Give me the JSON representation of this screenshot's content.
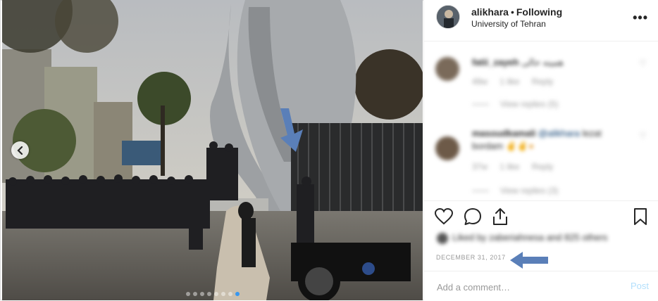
{
  "post": {
    "username": "alikhara",
    "separator": "•",
    "follow_state": "Following",
    "location": "University of Tehran",
    "more_icon": "more-options-icon",
    "date": "DECEMBER 31, 2017"
  },
  "comments": [
    {
      "username": "fatii_zayeh",
      "text": "همینه حالی",
      "meta": [
        "49w",
        "1 like",
        "Reply"
      ],
      "replies": "View replies (5)"
    },
    {
      "username": "masoudkamali",
      "mention": "@alikhara",
      "text": "lezat",
      "text2": "bordam",
      "emoji": "✌✌●",
      "meta": [
        "37w",
        "1 like",
        "Reply"
      ],
      "replies": "View replies (3)"
    }
  ],
  "likes_text": "Liked by zaberiahnesa and 825 others",
  "add_comment": {
    "placeholder": "Add a comment…",
    "post_label": "Post"
  },
  "carousel": {
    "dot_count": 8,
    "active_index": 7
  },
  "colors": {
    "accent_blue": "#3897f0",
    "post_disabled": "#b2dffc",
    "annotation_arrow": "#5a7fb8"
  }
}
